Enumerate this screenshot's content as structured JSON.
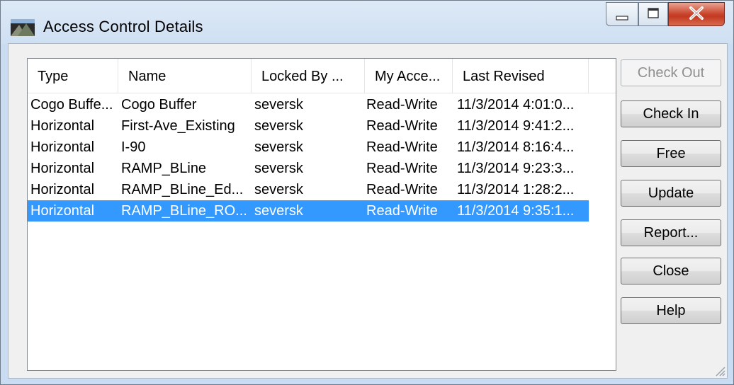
{
  "window": {
    "title": "Access Control Details"
  },
  "list": {
    "columns": [
      "Type",
      "Name",
      "Locked By ...",
      "My Acce...",
      "Last Revised"
    ],
    "rows": [
      {
        "type": "Cogo Buffe...",
        "name": "Cogo Buffer",
        "locked_by": "seversk",
        "access": "Read-Write",
        "revised": "11/3/2014 4:01:0...",
        "selected": false
      },
      {
        "type": "Horizontal",
        "name": "First-Ave_Existing",
        "locked_by": "seversk",
        "access": "Read-Write",
        "revised": "11/3/2014 9:41:2...",
        "selected": false
      },
      {
        "type": "Horizontal",
        "name": "I-90",
        "locked_by": "seversk",
        "access": "Read-Write",
        "revised": "11/3/2014 8:16:4...",
        "selected": false
      },
      {
        "type": "Horizontal",
        "name": "RAMP_BLine",
        "locked_by": "seversk",
        "access": "Read-Write",
        "revised": "11/3/2014 9:23:3...",
        "selected": false
      },
      {
        "type": "Horizontal",
        "name": "RAMP_BLine_Ed...",
        "locked_by": "seversk",
        "access": "Read-Write",
        "revised": "11/3/2014 1:28:2...",
        "selected": false
      },
      {
        "type": "Horizontal",
        "name": "RAMP_BLine_RO...",
        "locked_by": "seversk",
        "access": "Read-Write",
        "revised": "11/3/2014 9:35:1...",
        "selected": true
      }
    ]
  },
  "buttons": {
    "check_out": "Check Out",
    "check_in": "Check In",
    "free": "Free",
    "update": "Update",
    "report": "Report...",
    "close": "Close",
    "help": "Help"
  },
  "colors": {
    "selection": "#3399ff",
    "close_button": "#c9442b"
  },
  "icons": [
    "app-icon",
    "minimize-icon",
    "maximize-icon",
    "close-icon",
    "resize-grip-icon"
  ]
}
